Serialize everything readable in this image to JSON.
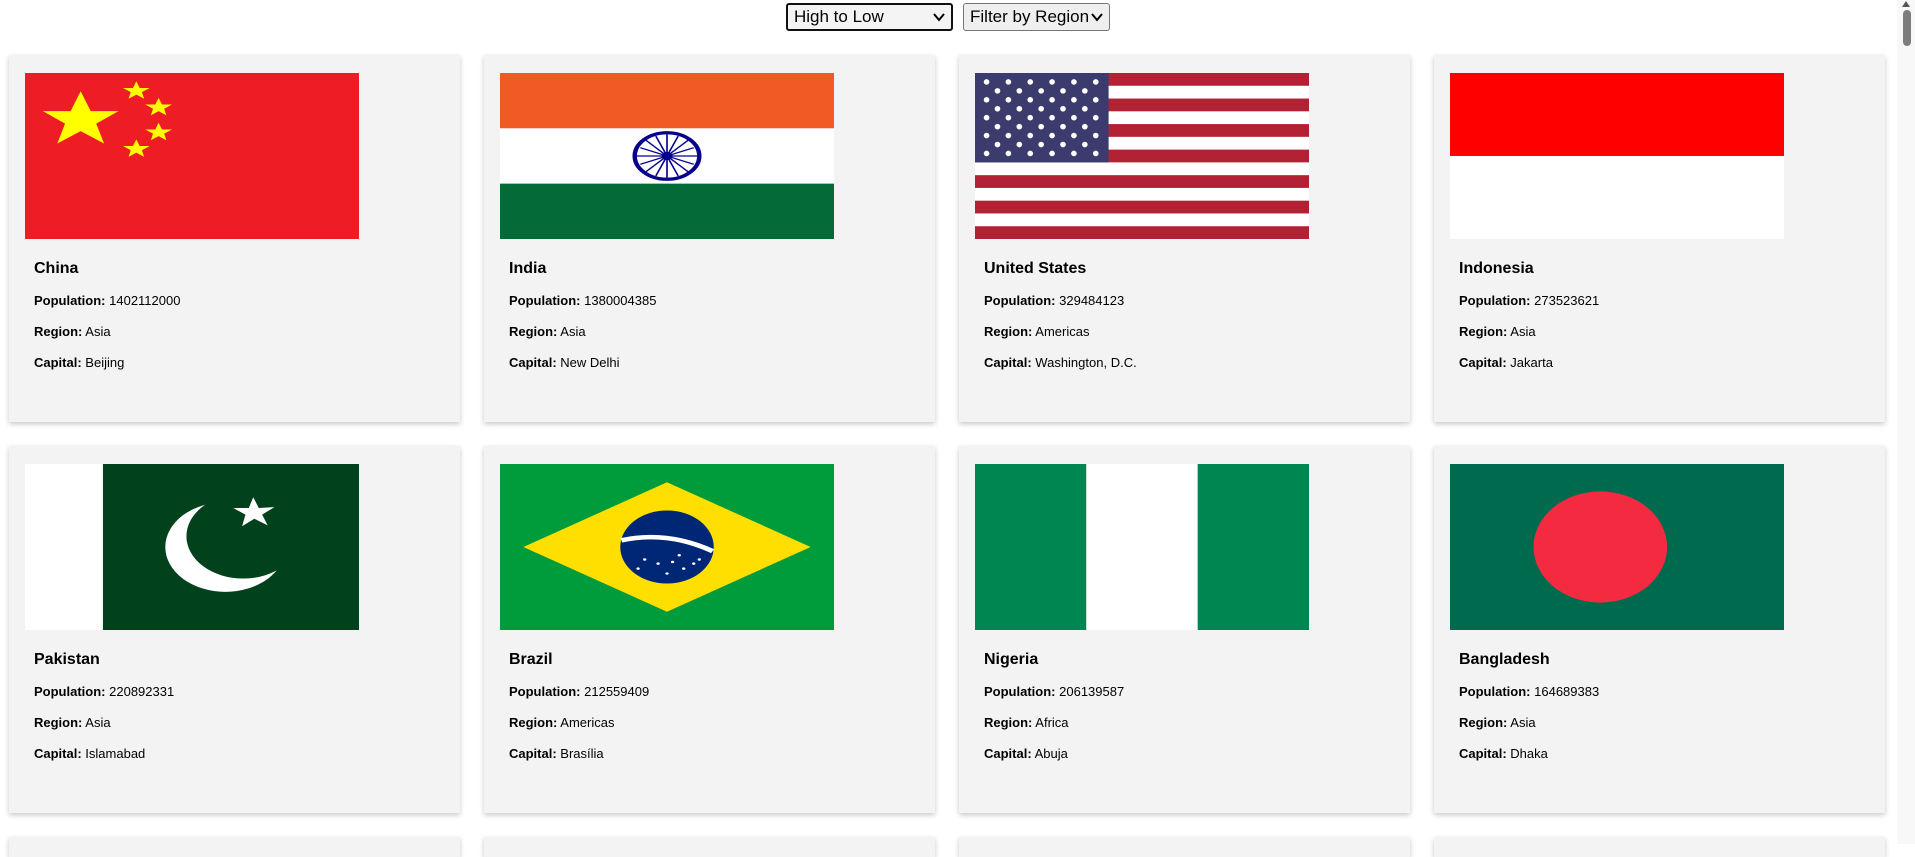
{
  "controls": {
    "sort_value": "High to Low",
    "region_value": "Filter by Region"
  },
  "labels": {
    "population": "Population:",
    "region": "Region:",
    "capital": "Capital:"
  },
  "countries": [
    {
      "name": "China",
      "population": "1402112000",
      "region": "Asia",
      "capital": "Beijing",
      "flag_icon": "china-flag-icon"
    },
    {
      "name": "India",
      "population": "1380004385",
      "region": "Asia",
      "capital": "New Delhi",
      "flag_icon": "india-flag-icon"
    },
    {
      "name": "United States",
      "population": "329484123",
      "region": "Americas",
      "capital": "Washington, D.C.",
      "flag_icon": "usa-flag-icon"
    },
    {
      "name": "Indonesia",
      "population": "273523621",
      "region": "Asia",
      "capital": "Jakarta",
      "flag_icon": "indonesia-flag-icon"
    },
    {
      "name": "Pakistan",
      "population": "220892331",
      "region": "Asia",
      "capital": "Islamabad",
      "flag_icon": "pakistan-flag-icon"
    },
    {
      "name": "Brazil",
      "population": "212559409",
      "region": "Americas",
      "capital": "Brasília",
      "flag_icon": "brazil-flag-icon"
    },
    {
      "name": "Nigeria",
      "population": "206139587",
      "region": "Africa",
      "capital": "Abuja",
      "flag_icon": "nigeria-flag-icon"
    },
    {
      "name": "Bangladesh",
      "population": "164689383",
      "region": "Asia",
      "capital": "Dhaka",
      "flag_icon": "bangladesh-flag-icon"
    }
  ]
}
